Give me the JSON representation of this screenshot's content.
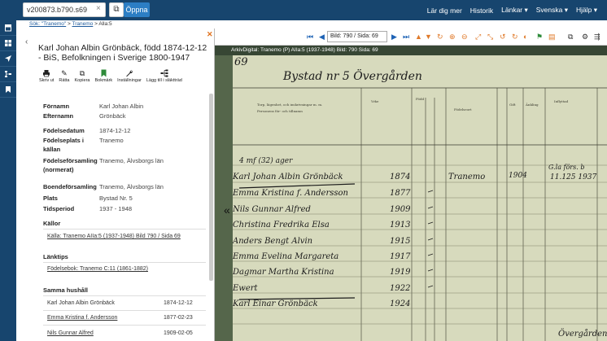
{
  "topbar": {
    "search_value": "v200873.b790.s69",
    "clear_icon": "×",
    "copy_icon": "⧉",
    "open_label": "Öppna",
    "nav": [
      "Lär dig mer",
      "Historik",
      "Länkar ▾",
      "Svenska ▾",
      "Hjälp ▾"
    ]
  },
  "sidebar": {
    "icons": [
      "archive-icon",
      "grid-icon",
      "locate-icon",
      "tree-icon",
      "bookmark-icon"
    ]
  },
  "breadcrumb": {
    "items": [
      "Sök: \"Tranemo\"",
      "Tranemo",
      "Alla:5"
    ],
    "separator": ">"
  },
  "panel": {
    "title": "Karl Johan Albin Grönbäck, född 1874-12-12 - BiS, Befolkningen i Sverige 1800-1947",
    "tools": [
      {
        "icon": "🖶",
        "label": "Skriv ut",
        "icon_color": "dark"
      },
      {
        "icon": "✎",
        "label": "Rätta",
        "icon_color": "dark"
      },
      {
        "icon": "⧉",
        "label": "Kopiera",
        "icon_color": "dark"
      },
      {
        "icon": "⚑",
        "label": "Bokmärk",
        "icon_color": "green"
      },
      {
        "icon": "🔧",
        "label": "Inställningar",
        "icon_color": "dark"
      },
      {
        "icon": "⇶",
        "label": "Lägg till i släktträd",
        "icon_color": "dark"
      }
    ],
    "fields": [
      {
        "label": "Förnamn",
        "value": "Karl Johan Albin"
      },
      {
        "label": "Efternamn",
        "value": "Grönbäck"
      },
      {
        "label": "Födelsedatum",
        "value": "1874-12-12"
      },
      {
        "label": "Födelseplats i källan",
        "value": "Tranemo"
      },
      {
        "label": "Födelseförsamling (normerat)",
        "value": "Tranemo, Älvsborgs län"
      },
      {
        "label": "Boendeförsamling",
        "value": "Tranemo, Älvsborgs län"
      },
      {
        "label": "Plats",
        "value": "Bystad Nr. 5"
      },
      {
        "label": "Tidsperiod",
        "value": "1937 - 1948"
      }
    ],
    "sources_heading": "Källor",
    "sources_link": "Källa: Tranemo AIIa:5 (1937-1948) Bild 790 / Sida 69",
    "links_heading": "Länktips",
    "links_link": "Födelsebok: Tranemo C:11 (1861-1882)",
    "household_heading": "Samma hushåll",
    "household": [
      {
        "name": "Karl Johan Albin Grönbäck",
        "date": "1874-12-12"
      },
      {
        "name": "Emma Kristina f. Andersson",
        "date": "1877-02-23"
      },
      {
        "name": "Nils Gunnar Alfred",
        "date": "1909-02-05"
      }
    ]
  },
  "viewer": {
    "page_select": "Bild: 790 / Sida: 69",
    "caption": "ArkivDigital: Tranemo (P) AIIa:5 (1937-1948) Bild: 790 Sida: 69",
    "page_number": "69",
    "place_heading": "Bystad nr 5 Övergården",
    "col_headers": [
      "Torp, lägenhet, ...",
      "Yrke",
      "Född",
      "Födelseort",
      "Gift",
      "Änkling",
      "Inflyttad"
    ],
    "rows": [
      "Karl Johan Albin Grönbäck",
      "Emma Kristina f. Andersson",
      "Nils Gunnar Alfred",
      "Christina Fredrika Elsa",
      "Anders Bengt Alvin",
      "Emma Evelina Margareta",
      "Dagmar Martha Kristina",
      "Ewert",
      "Karl Einar Grönbäck"
    ],
    "years": [
      "1874",
      "1877",
      "1909",
      "1913",
      "1915",
      "1917",
      "1919",
      "1922",
      "1924"
    ]
  }
}
